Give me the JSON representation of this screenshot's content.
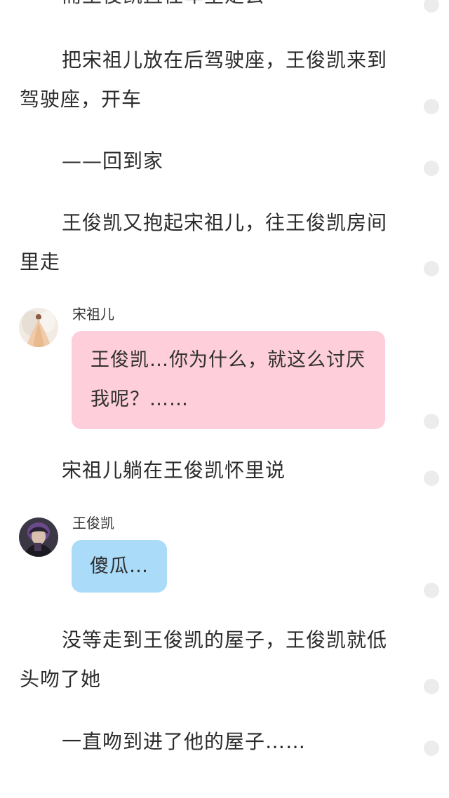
{
  "story": {
    "p0": "而王俊凯直往车里走去",
    "p1": "把宋祖儿放在后驾驶座，王俊凯来到驾驶座，开车",
    "p2": "——回到家",
    "p3": "王俊凯又抱起宋祖儿，往王俊凯房间里走",
    "p4": "宋祖儿躺在王俊凯怀里说",
    "p5": "没等走到王俊凯的屋子，王俊凯就低头吻了她",
    "p6": "一直吻到进了他的屋子……"
  },
  "chat": [
    {
      "speaker": "宋祖儿",
      "text": "王俊凯…你为什么，就这么讨厌我呢？……",
      "bubble_color": "#fecfda",
      "avatar_icon": "woman-in-dress-avatar"
    },
    {
      "speaker": "王俊凯",
      "text": "傻瓜…",
      "bubble_color": "#aadcfa",
      "avatar_icon": "man-portrait-avatar"
    }
  ],
  "sidebar_marker_icon": "paragraph-comment-dot"
}
